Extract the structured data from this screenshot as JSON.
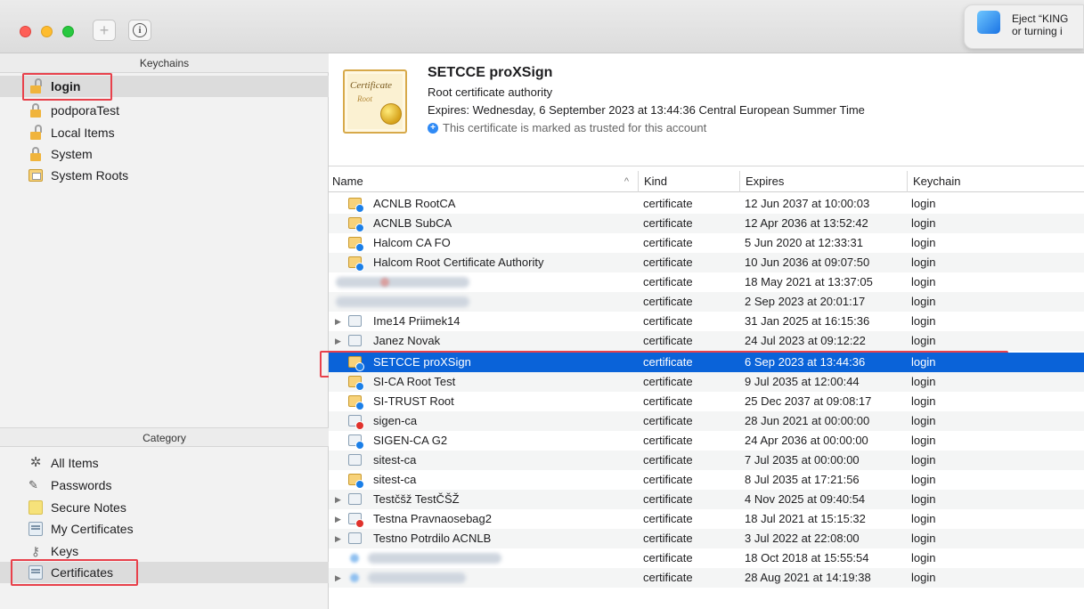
{
  "toolbar": {
    "add_label": "+",
    "info_label": "i"
  },
  "notification": {
    "line1": "Eject “KING",
    "line2": "or turning i"
  },
  "keychains": {
    "header": "Keychains",
    "items": [
      {
        "label": "login",
        "icon": "lock-open-icon"
      },
      {
        "label": "podporaTest",
        "icon": "lock-closed-icon"
      },
      {
        "label": "Local Items",
        "icon": "lock-open-icon"
      },
      {
        "label": "System",
        "icon": "lock-closed-icon"
      },
      {
        "label": "System Roots",
        "icon": "system-roots-icon"
      }
    ]
  },
  "category": {
    "header": "Category",
    "items": [
      {
        "label": "All Items",
        "icon": "all-items-icon"
      },
      {
        "label": "Passwords",
        "icon": "passwords-icon"
      },
      {
        "label": "Secure Notes",
        "icon": "secure-notes-icon"
      },
      {
        "label": "My Certificates",
        "icon": "my-certificates-icon"
      },
      {
        "label": "Keys",
        "icon": "key-icon"
      },
      {
        "label": "Certificates",
        "icon": "certificates-icon"
      }
    ]
  },
  "detail": {
    "cert_word": "Certificate",
    "cert_word2": "Root",
    "title": "SETCCE proXSign",
    "subtitle": "Root certificate authority",
    "expires": "Expires: Wednesday, 6 September 2023 at 13:44:36 Central European Summer Time",
    "trust": "This certificate is marked as trusted for this account",
    "trust_icon_glyph": "+"
  },
  "table": {
    "columns": {
      "name": "Name",
      "kind": "Kind",
      "expires": "Expires",
      "keychain": "Keychain"
    },
    "sort_glyph": "^",
    "disclosure_glyph": "▶",
    "rows": [
      {
        "name": "ACNLB RootCA",
        "kind": "certificate",
        "expires": "12 Jun 2037 at 10:00:03",
        "keychain": "login"
      },
      {
        "name": "ACNLB SubCA",
        "kind": "certificate",
        "expires": "12 Apr 2036 at 13:52:42",
        "keychain": "login"
      },
      {
        "name": "Halcom CA FO",
        "kind": "certificate",
        "expires": "5 Jun 2020 at 12:33:31",
        "keychain": "login"
      },
      {
        "name": "Halcom Root Certificate Authority",
        "kind": "certificate",
        "expires": "10 Jun 2036 at 09:07:50",
        "keychain": "login"
      },
      {
        "name": "",
        "kind": "certificate",
        "expires": "18 May 2021 at 13:37:05",
        "keychain": "login"
      },
      {
        "name": "",
        "kind": "certificate",
        "expires": "2 Sep 2023 at 20:01:17",
        "keychain": "login"
      },
      {
        "name": "Ime14 Priimek14",
        "kind": "certificate",
        "expires": "31 Jan 2025 at 16:15:36",
        "keychain": "login"
      },
      {
        "name": "Janez Novak",
        "kind": "certificate",
        "expires": "24 Jul 2023 at 09:12:22",
        "keychain": "login"
      },
      {
        "name": "SETCCE proXSign",
        "kind": "certificate",
        "expires": "6 Sep 2023 at 13:44:36",
        "keychain": "login"
      },
      {
        "name": "SI-CA Root Test",
        "kind": "certificate",
        "expires": "9 Jul 2035 at 12:00:44",
        "keychain": "login"
      },
      {
        "name": "SI-TRUST Root",
        "kind": "certificate",
        "expires": "25 Dec 2037 at 09:08:17",
        "keychain": "login"
      },
      {
        "name": "sigen-ca",
        "kind": "certificate",
        "expires": "28 Jun 2021 at 00:00:00",
        "keychain": "login"
      },
      {
        "name": "SIGEN-CA G2",
        "kind": "certificate",
        "expires": "24 Apr 2036 at 00:00:00",
        "keychain": "login"
      },
      {
        "name": "sitest-ca",
        "kind": "certificate",
        "expires": "7 Jul 2035 at 00:00:00",
        "keychain": "login"
      },
      {
        "name": "sitest-ca",
        "kind": "certificate",
        "expires": "8 Jul 2035 at 17:21:56",
        "keychain": "login"
      },
      {
        "name": "Testčšž TestČŠŽ",
        "kind": "certificate",
        "expires": "4 Nov 2025 at 09:40:54",
        "keychain": "login"
      },
      {
        "name": "Testna Pravnaosebag2",
        "kind": "certificate",
        "expires": "18 Jul 2021 at 15:15:32",
        "keychain": "login"
      },
      {
        "name": "Testno Potrdilo ACNLB",
        "kind": "certificate",
        "expires": "3 Jul 2022 at 22:08:00",
        "keychain": "login"
      },
      {
        "name": "",
        "kind": "certificate",
        "expires": "18 Oct 2018 at 15:55:54",
        "keychain": "login"
      },
      {
        "name": "",
        "kind": "certificate",
        "expires": "28 Aug 2021 at 14:19:38",
        "keychain": "login"
      }
    ]
  },
  "colors": {
    "selection": "#0a63d9",
    "highlight": "#e8414b"
  }
}
